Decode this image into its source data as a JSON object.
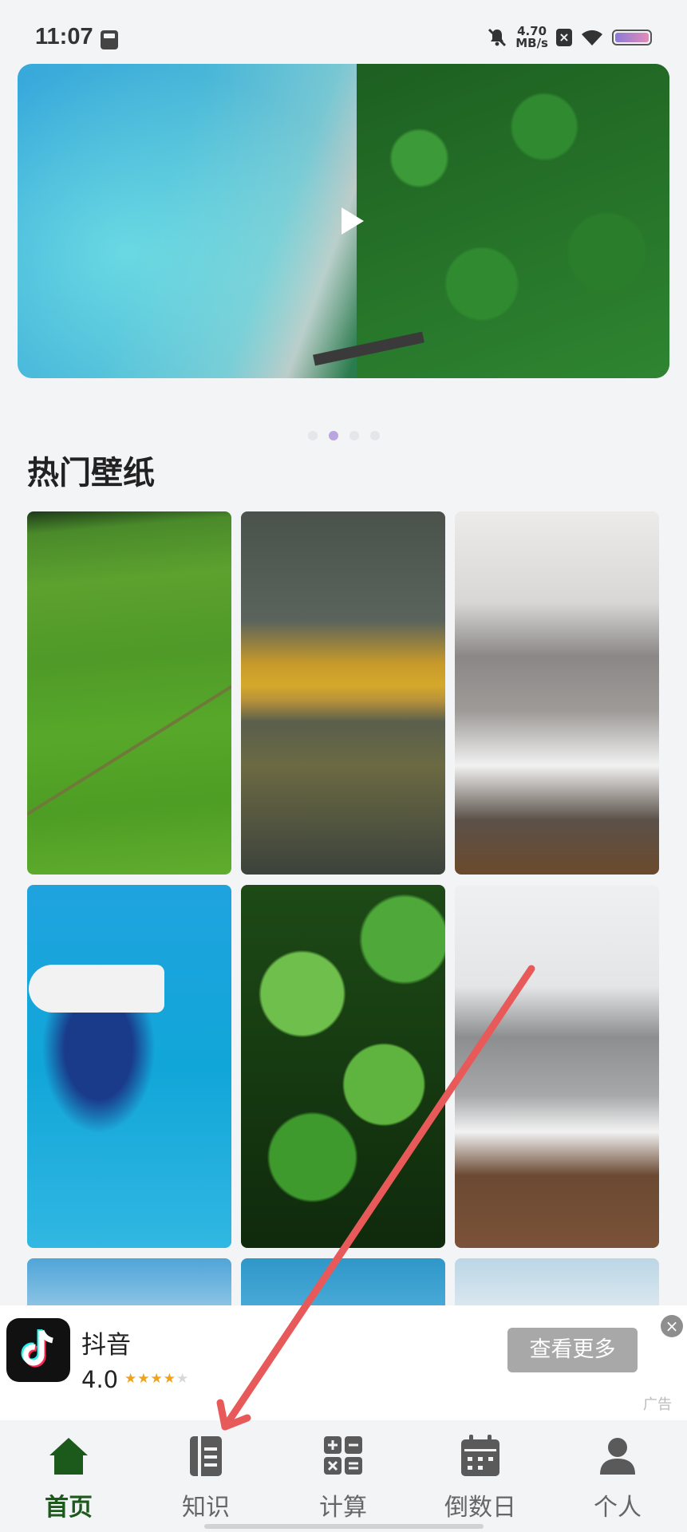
{
  "status_bar": {
    "time": "11:07",
    "speed_value": "4.70",
    "speed_unit": "MB/s"
  },
  "banner": {
    "media": "aerial tropical island video",
    "dots": 4,
    "active_dot": 2
  },
  "section": {
    "title": "热门壁纸"
  },
  "wallpapers": [
    {
      "name": "green-fields"
    },
    {
      "name": "autumn-lake"
    },
    {
      "name": "snowy-mountain"
    },
    {
      "name": "sailboat-sea"
    },
    {
      "name": "green-leaves"
    },
    {
      "name": "misty-mountain"
    }
  ],
  "ad": {
    "app_name": "抖音",
    "rating": "4.0",
    "stars_filled": 4,
    "button": "查看更多",
    "close": "×",
    "label": "广告"
  },
  "nav": {
    "items": [
      {
        "label": "首页",
        "icon": "home-icon",
        "active": true
      },
      {
        "label": "知识",
        "icon": "notebook-icon",
        "active": false
      },
      {
        "label": "计算",
        "icon": "calculator-icon",
        "active": false
      },
      {
        "label": "倒数日",
        "icon": "calendar-icon",
        "active": false
      },
      {
        "label": "个人",
        "icon": "person-icon",
        "active": false
      }
    ]
  },
  "colors": {
    "accent": "#1b5a1a",
    "annotation_arrow": "#e85a5a"
  }
}
